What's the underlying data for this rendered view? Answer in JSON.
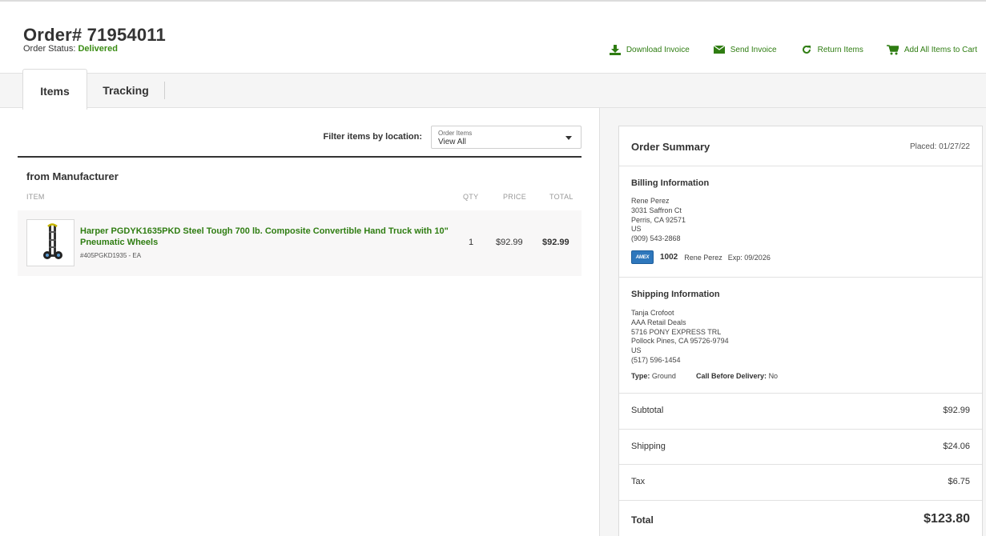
{
  "header": {
    "order_title": "Order# 71954011",
    "status_label": "Order Status:",
    "status_value": "Delivered"
  },
  "actions": {
    "download_invoice": "Download Invoice",
    "send_invoice": "Send Invoice",
    "return_items": "Return Items",
    "add_all_to_cart": "Add All Items to Cart"
  },
  "tabs": {
    "items": "Items",
    "tracking": "Tracking",
    "active": "Items"
  },
  "filter": {
    "label": "Filter items by location:",
    "caption": "Order Items",
    "value": "View All"
  },
  "items_section": {
    "group_title": "from Manufacturer",
    "columns": {
      "item": "ITEM",
      "qty": "QTY",
      "price": "PRICE",
      "total": "TOTAL"
    },
    "rows": [
      {
        "name": "Harper PGDYK1635PKD Steel Tough 700 lb. Composite Convertible Hand Truck with 10\" Pneumatic Wheels",
        "sku": "#405PGKD1935 - EA",
        "qty": "1",
        "price": "$92.99",
        "total": "$92.99",
        "thumb_icon": "hand-truck-icon"
      }
    ]
  },
  "summary": {
    "title": "Order Summary",
    "placed": "Placed: 01/27/22",
    "billing": {
      "title": "Billing Information",
      "lines": [
        "Rene Perez",
        "3031 Saffron Ct",
        "Perris, CA 92571",
        "US",
        "(909) 543-2868"
      ],
      "card_brand": "AMEX",
      "card_last4": "1002",
      "card_name": "Rene Perez",
      "card_exp": "Exp: 09/2026"
    },
    "shipping": {
      "title": "Shipping Information",
      "lines": [
        "Tanja Crofoot",
        "AAA Retail Deals",
        "5716 PONY EXPRESS TRL",
        "Pollock Pines, CA 95726-9794",
        "US",
        "(517) 596-1454"
      ],
      "type_label": "Type:",
      "type_value": "Ground",
      "call_label": "Call Before Delivery:",
      "call_value": "No"
    },
    "subtotal_label": "Subtotal",
    "subtotal_value": "$92.99",
    "shipping_label": "Shipping",
    "shipping_value": "$24.06",
    "tax_label": "Tax",
    "tax_value": "$6.75",
    "total_label": "Total",
    "total_value": "$123.80"
  },
  "colors": {
    "accent_green": "#2f7d12",
    "status_green": "#3a8c14",
    "amex_blue": "#2e77bc"
  }
}
